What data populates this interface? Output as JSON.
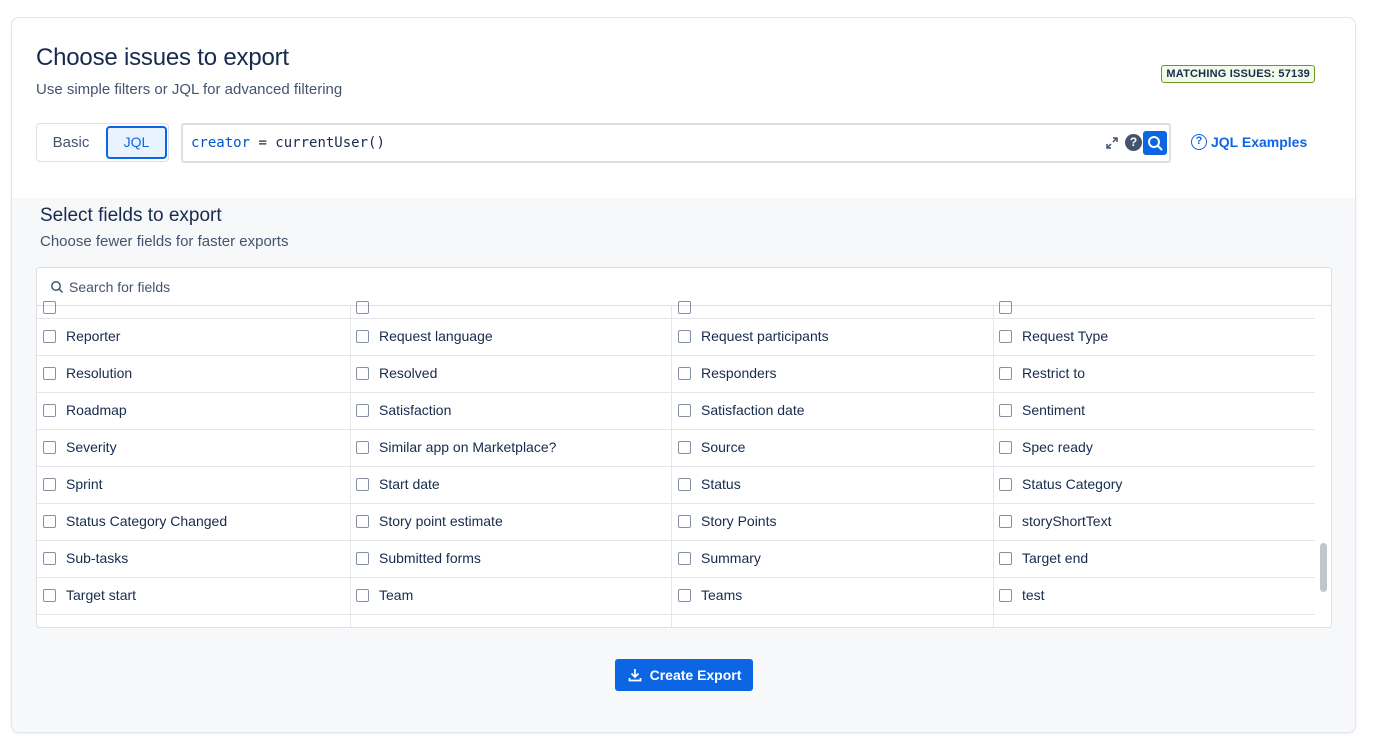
{
  "header": {
    "title": "Choose issues to export",
    "subtitle": "Use simple filters or JQL for advanced filtering",
    "matching_issues": "MATCHING ISSUES: 57139"
  },
  "mode_toggle": {
    "basic_label": "Basic",
    "jql_label": "JQL",
    "selected": "JQL"
  },
  "jql": {
    "query_keyword": "creator",
    "query_rest": " = currentUser()",
    "examples_link": "JQL Examples"
  },
  "fields_section": {
    "title": "Select fields to export",
    "subtitle": "Choose fewer fields for faster exports",
    "search_placeholder": "Search for fields",
    "columns": [
      [
        "Reporter",
        "Resolution",
        "Roadmap",
        "Severity",
        "Sprint",
        "Status Category Changed",
        "Sub-tasks",
        "Target start"
      ],
      [
        "Request language",
        "Resolved",
        "Satisfaction",
        "Similar app on Marketplace?",
        "Start date",
        "Story point estimate",
        "Submitted forms",
        "Team"
      ],
      [
        "Request participants",
        "Responders",
        "Satisfaction date",
        "Source",
        "Status",
        "Story Points",
        "Summary",
        "Teams"
      ],
      [
        "Request Type",
        "Restrict to",
        "Sentiment",
        "Spec ready",
        "Status Category",
        "storyShortText",
        "Target end",
        "test"
      ]
    ]
  },
  "actions": {
    "create_export": "Create Export"
  },
  "colors": {
    "brand": "#0c66e4",
    "badge_border": "#6a9a23"
  },
  "icons": [
    "expand-icon",
    "help-icon",
    "search-icon",
    "question-circle-icon",
    "download-icon"
  ]
}
